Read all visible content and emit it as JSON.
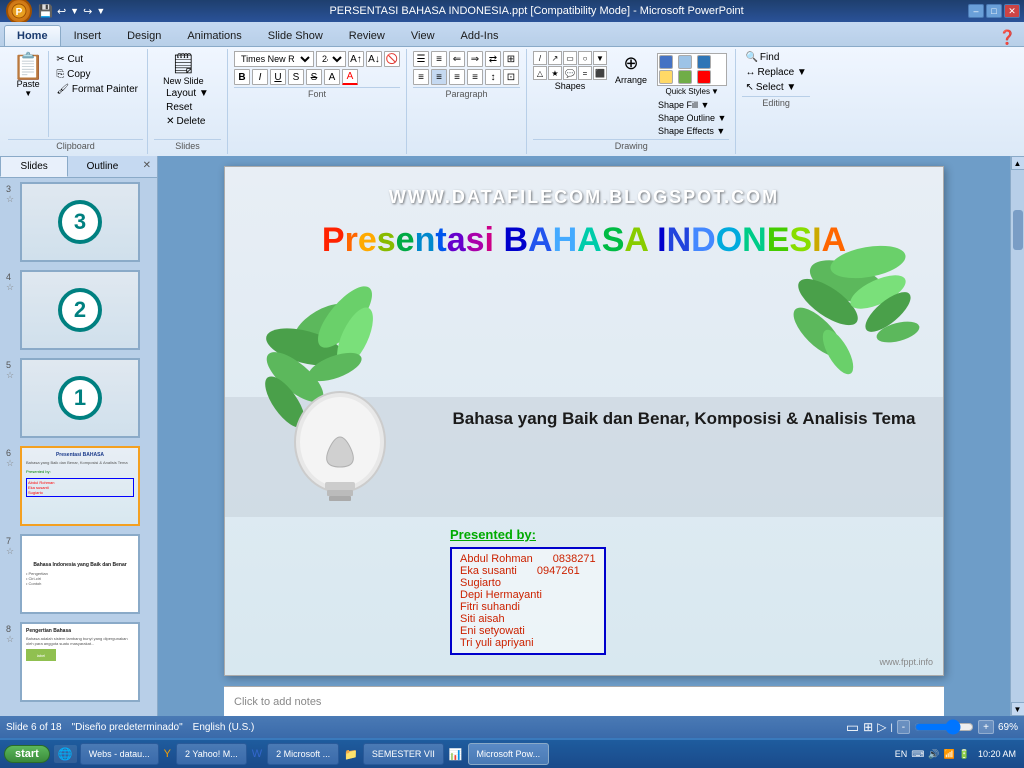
{
  "titleBar": {
    "title": "PERSENTASI BAHASA INDONESIA.ppt [Compatibility Mode] - Microsoft PowerPoint",
    "minimize": "–",
    "maximize": "□",
    "close": "✕"
  },
  "quickAccess": {
    "save": "💾",
    "undo": "↩",
    "redo": "↪",
    "customizeLabel": "▼"
  },
  "tabs": {
    "home": "Home",
    "insert": "Insert",
    "design": "Design",
    "animations": "Animations",
    "slideShow": "Slide Show",
    "review": "Review",
    "view": "View",
    "addIns": "Add-Ins"
  },
  "ribbon": {
    "clipboardGroup": {
      "label": "Clipboard",
      "paste": "Paste",
      "cut": "✂ Cut",
      "copy": "⎘ Copy",
      "formatPainter": "🖌 Format Painter"
    },
    "slidesGroup": {
      "label": "Slides",
      "newSlide": "New Slide",
      "layout": "Layout ▼",
      "reset": "Reset",
      "delete": "Delete"
    },
    "fontGroup": {
      "label": "Font",
      "fontName": "Times New Roman",
      "fontSize": "24",
      "bold": "B",
      "italic": "I",
      "underline": "U",
      "strikethrough": "S̶",
      "shadow": "S",
      "charSpacing": "A",
      "fontColor": "A",
      "clearFormatting": "🚫",
      "increase": "A↑",
      "decrease": "A↓"
    },
    "paragraphGroup": {
      "label": "Paragraph",
      "bulletList": "☰",
      "numberedList": "≡",
      "decIndent": "⇐",
      "incIndent": "⇒",
      "direction": "⇄",
      "columns": "⊞",
      "alignLeft": "≡",
      "alignCenter": "≡",
      "alignRight": "≡",
      "justify": "≡",
      "lineSpacing": "↕",
      "convertToSmArt": "⊡"
    },
    "drawingGroup": {
      "label": "Drawing",
      "shapeFill": "Shape Fill ▼",
      "shapeOutline": "Shape Outline ▼",
      "shapeEffects": "Shape Effects ▼",
      "arrange": "Arrange",
      "quickStyles": "Quick Styles"
    },
    "editingGroup": {
      "label": "Editing",
      "find": "Find",
      "replace": "Replace ▼",
      "select": "Select ▼"
    }
  },
  "slidesPanel": {
    "tabs": [
      "Slides",
      "Outline"
    ],
    "slides": [
      {
        "num": "3",
        "active": false
      },
      {
        "num": "4",
        "active": false
      },
      {
        "num": "5",
        "active": false
      },
      {
        "num": "6",
        "active": true
      },
      {
        "num": "7",
        "active": false
      },
      {
        "num": "8",
        "active": false
      }
    ]
  },
  "mainSlide": {
    "watermark": "WWW.DATAFILECOM.BLOGSPOT.COM",
    "titleLetters": [
      "P",
      "r",
      "e",
      "s",
      "e",
      "n",
      "t",
      "a",
      "s",
      "i",
      " ",
      "B",
      "A",
      "H",
      "A",
      "S",
      "A",
      " ",
      "I",
      "N",
      "D",
      "O",
      "N",
      "E",
      "S",
      "I",
      "A"
    ],
    "titleRainbow": "Presentasi BAHASA INDONESIA",
    "subtitle": "Bahasa yang Baik dan Benar, Komposisi & Analisis Tema",
    "presentedBy": "Presented by:",
    "names": [
      {
        "name": "Abdul Rohman",
        "id": "0838271"
      },
      {
        "name": "Eka susanti",
        "id": "0947261"
      },
      {
        "name": "Sugiarto",
        "id": ""
      },
      {
        "name": "Depi Hermayanti",
        "id": ""
      },
      {
        "name": "Fitri suhandi",
        "id": ""
      },
      {
        "name": "Siti aisah",
        "id": ""
      },
      {
        "name": "Eni setyowati",
        "id": ""
      },
      {
        "name": "Tri yuli apriyani",
        "id": ""
      }
    ],
    "fpptWatermark": "www.fppt.info"
  },
  "notesArea": {
    "placeholder": "Click to add notes"
  },
  "statusBar": {
    "slideInfo": "Slide 6 of 18",
    "theme": "\"Diseño predeterminado\"",
    "language": "English (U.S.)",
    "viewNormal": "▭",
    "viewSlideSort": "⊞",
    "viewSlideShow": "▷",
    "zoom": "69%",
    "zoomOut": "-",
    "zoomIn": "+"
  },
  "taskbar": {
    "start": "start",
    "items": [
      {
        "label": "Webs - datau...",
        "active": false
      },
      {
        "label": "2 Yahoo! M...",
        "active": false
      },
      {
        "label": "2 Microsoft ...",
        "active": false
      },
      {
        "label": "SEMESTER VII",
        "active": false
      },
      {
        "label": "Microsoft Pow...",
        "active": true
      }
    ],
    "systemTray": "EN",
    "time": "10:20 AM"
  }
}
